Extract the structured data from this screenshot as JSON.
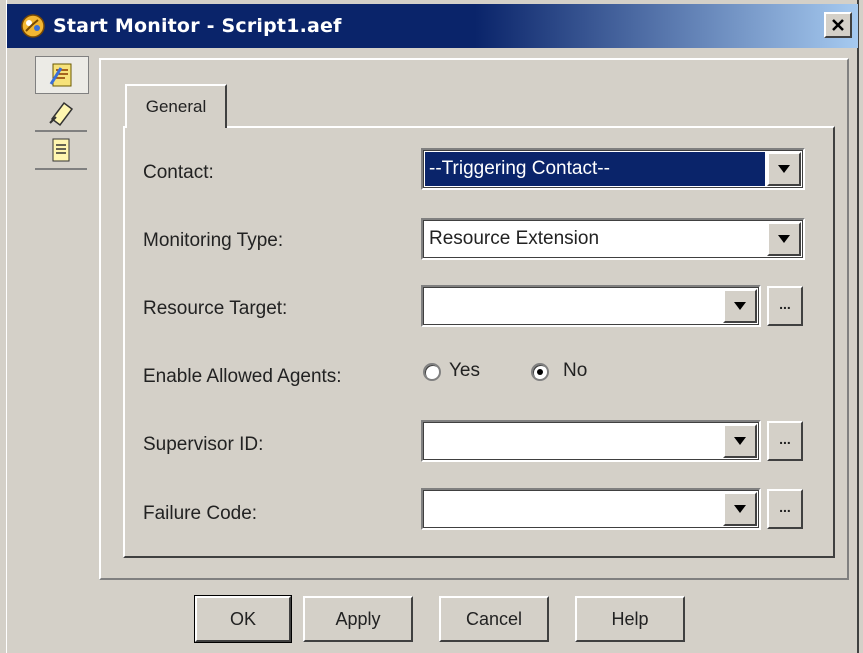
{
  "window": {
    "title": "Start Monitor - Script1.aef"
  },
  "sidebar": {
    "icons": [
      "general-page-icon",
      "edit-tag-icon",
      "notes-page-icon"
    ]
  },
  "tabs": [
    {
      "label": "General",
      "active": true
    }
  ],
  "form": {
    "contact": {
      "label": "Contact:",
      "value": "--Triggering Contact--"
    },
    "monitoring_type": {
      "label": "Monitoring Type:",
      "value": "Resource Extension"
    },
    "resource_target": {
      "label": "Resource Target:",
      "value": "",
      "browse": "..."
    },
    "enable_allowed_agents": {
      "label": "Enable Allowed Agents:",
      "options": [
        "Yes",
        "No"
      ],
      "selected": "No"
    },
    "supervisor_id": {
      "label": "Supervisor ID:",
      "value": "",
      "browse": "..."
    },
    "failure_code": {
      "label": "Failure Code:",
      "value": "",
      "browse": "..."
    }
  },
  "buttons": {
    "ok": "OK",
    "apply": "Apply",
    "cancel": "Cancel",
    "help": "Help"
  },
  "colors": {
    "title_bar": "#0a246a",
    "selection": "#0a246a",
    "face": "#d4d0c8"
  }
}
